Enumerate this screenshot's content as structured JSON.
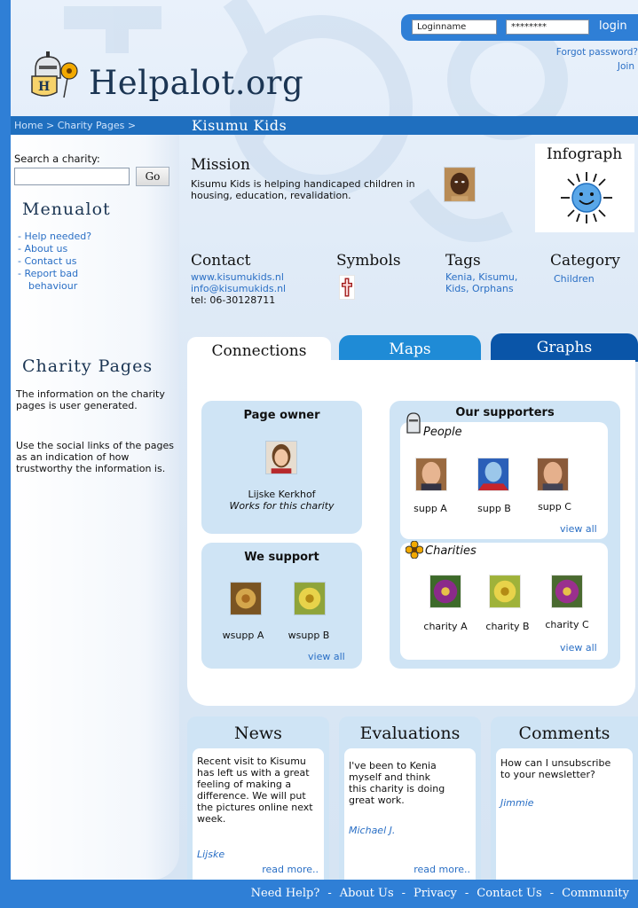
{
  "header": {
    "login_name_value": "Loginname",
    "password_value": "********",
    "login_label": "login",
    "forgot_label": "Forgot password?",
    "join_label": "Join",
    "site_title": "Helpalot.org"
  },
  "breadcrumb": {
    "text": "Home > Charity Pages >",
    "page_title": "Kisumu Kids"
  },
  "sidebar": {
    "search_label": "Search a charity:",
    "go_label": "Go",
    "menu_title": "Menualot",
    "menu_items": [
      "- Help needed?",
      "- About us",
      "- Contact us",
      "- Report bad",
      "behaviour"
    ],
    "charity_title": "Charity Pages",
    "para1": "The information on the charity pages is user generated.",
    "para2": "Use the social links of the pages as an indication of how trustworthy the information is."
  },
  "mission": {
    "title": "Mission",
    "text": "Kisumu Kids is helping handicaped children in housing, education, revalidation."
  },
  "infograph": {
    "title": "Infograph"
  },
  "contact": {
    "title": "Contact",
    "website": "www.kisumukids.nl",
    "email": "info@kisumukids.nl",
    "tel": "tel: 06-30128711"
  },
  "symbols": {
    "title": "Symbols"
  },
  "tags": {
    "title": "Tags",
    "line1": "Kenia, Kisumu,",
    "line2": "Kids, Orphans"
  },
  "category": {
    "title": "Category",
    "value": "Children"
  },
  "tabs": [
    "Connections",
    "Maps",
    "Graphs"
  ],
  "page_owner": {
    "title": "Page owner",
    "name": "Lijske Kerkhof",
    "role": "Works for this charity"
  },
  "we_support": {
    "title": "We support",
    "items": [
      "wsupp A",
      "wsupp B"
    ],
    "view_all": "view all"
  },
  "our_supporters": {
    "title": "Our supporters",
    "people_label": "People",
    "people": [
      "supp A",
      "supp B",
      "supp C"
    ],
    "people_view_all": "view all",
    "charities_label": "Charities",
    "charities": [
      "charity A",
      "charity B",
      "charity C"
    ],
    "charities_view_all": "view all"
  },
  "news": {
    "title": "News",
    "lines": [
      "Recent visit to Kisumu",
      "has left us with a great",
      "feeling of making a",
      "difference. We will put",
      "the pictures online next",
      "week."
    ],
    "author": "Lijske",
    "more": "read more.."
  },
  "evaluations": {
    "title": "Evaluations",
    "lines": [
      "I've been to Kenia",
      "myself and think",
      "this charity is doing",
      "great work."
    ],
    "author": "Michael J.",
    "more": "read more.."
  },
  "comments": {
    "title": "Comments",
    "lines": [
      "How can I unsubscribe",
      "to your newsletter?"
    ],
    "author": "Jimmie"
  },
  "footer": [
    "Need Help?",
    "About Us",
    "Privacy",
    "Contact Us",
    "Community"
  ],
  "colors": {
    "brand_blue": "#2f7fd6",
    "bar_blue": "#1f6fbf",
    "tab_maps": "#1f8bd6",
    "tab_graphs": "#0a55a8",
    "card_blue": "#cfe4f5",
    "link": "#2a6fc5"
  }
}
